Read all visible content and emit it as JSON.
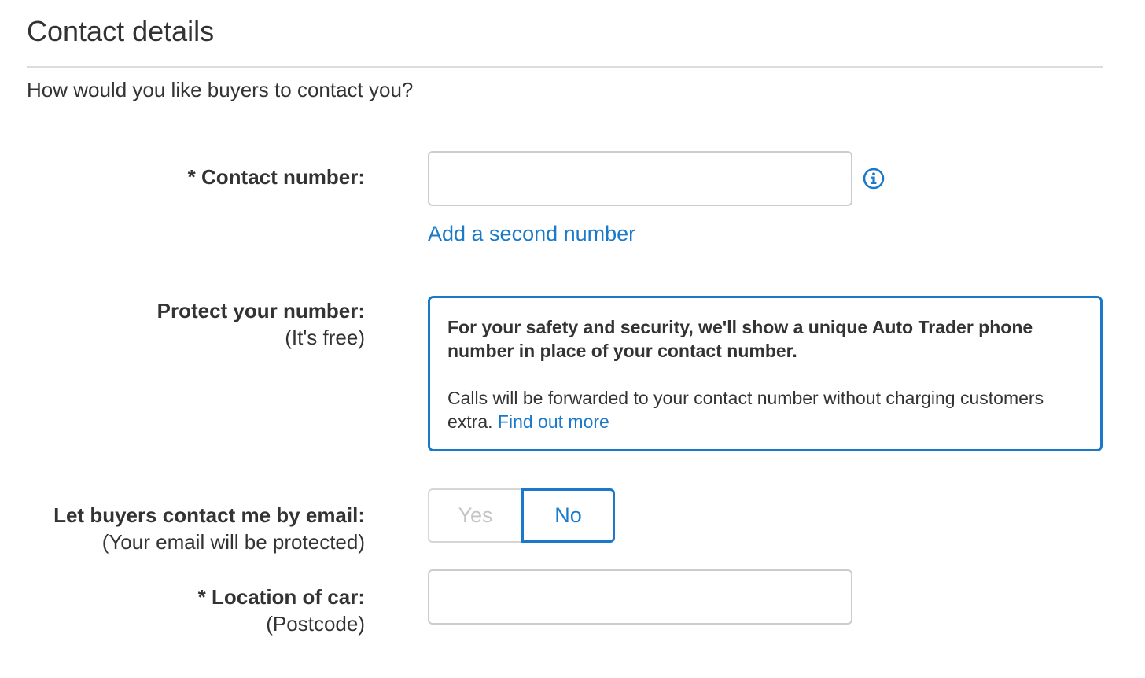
{
  "section": {
    "title": "Contact details",
    "intro": "How would you like buyers to contact you?"
  },
  "contact_number": {
    "label": "* Contact number:",
    "value": "",
    "placeholder": "",
    "info_icon": "info-circle-icon",
    "add_second_link": "Add a second number"
  },
  "protect_number": {
    "label": "Protect your number:",
    "sublabel": "(It's free)",
    "notice_strong": "For your safety and security, we'll show a unique Auto Trader phone number in place of your contact number.",
    "notice_body": "Calls will be forwarded to your contact number without charging customers extra.",
    "find_out_more": "Find out more"
  },
  "email_contact": {
    "label": "Let buyers contact me by email:",
    "sublabel": "(Your email will be protected)",
    "options": [
      "Yes",
      "No"
    ],
    "selected": "No"
  },
  "location": {
    "label": "* Location of car:",
    "sublabel": "(Postcode)",
    "value": "",
    "placeholder": ""
  },
  "colors": {
    "accent": "#1a7ac9",
    "text": "#333333",
    "border": "#cccccc",
    "divider": "#dcdcdc",
    "disabled_text": "#c4c4c4"
  }
}
